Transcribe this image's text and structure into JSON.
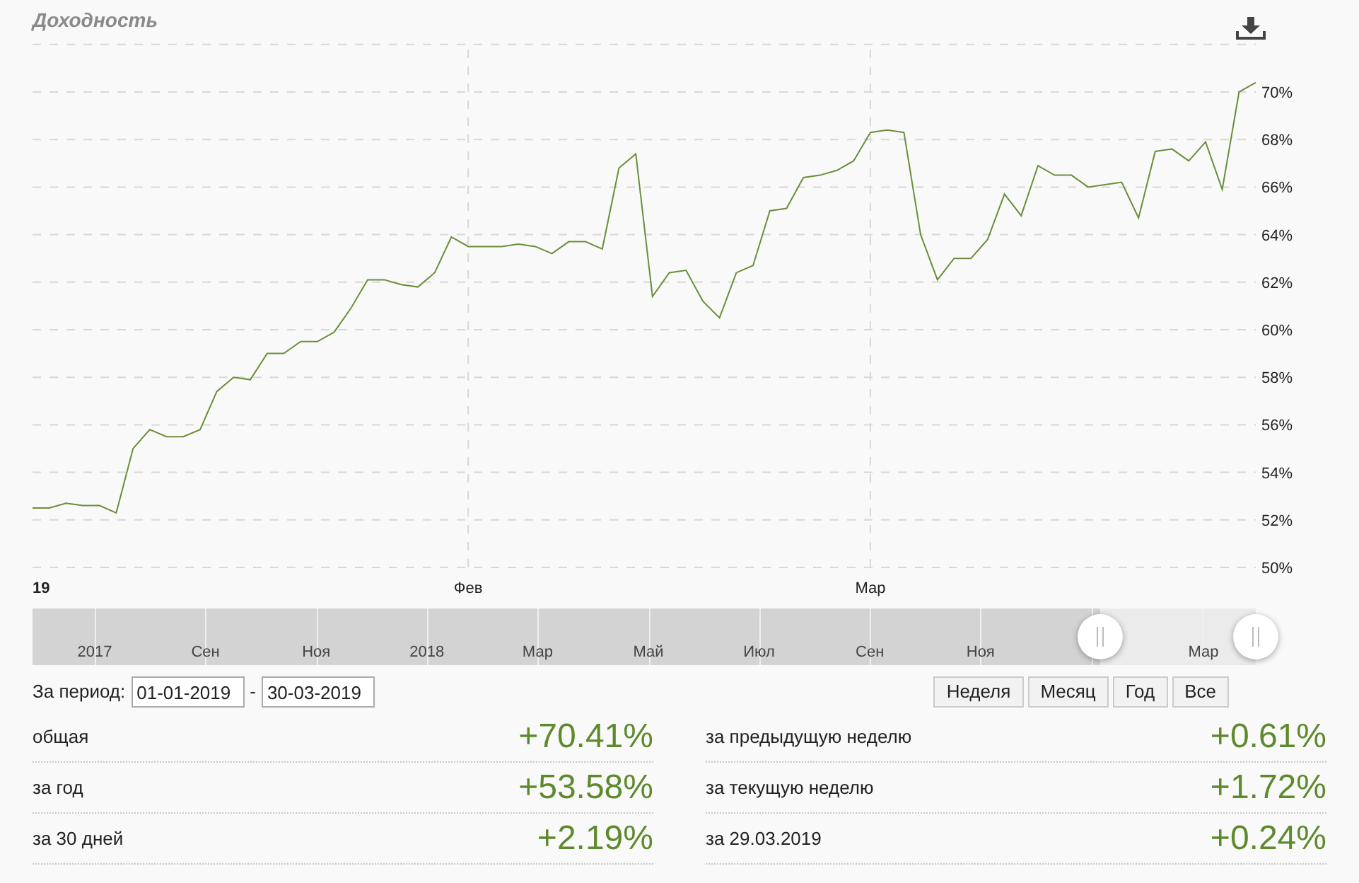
{
  "title": "Доходность",
  "chart": {
    "chart_data": {
      "type": "line",
      "categories": [
        "19",
        null,
        null,
        null,
        null,
        null,
        null,
        null,
        null,
        null,
        null,
        null,
        null,
        null,
        null,
        null,
        null,
        null,
        null,
        null,
        null,
        null,
        null,
        null,
        null,
        null,
        "Фев",
        null,
        null,
        null,
        null,
        null,
        null,
        null,
        null,
        null,
        null,
        null,
        null,
        null,
        null,
        null,
        null,
        null,
        null,
        null,
        null,
        null,
        null,
        null,
        "Мар",
        null,
        null,
        null,
        null,
        null,
        null,
        null,
        null,
        null,
        null,
        null,
        null,
        null,
        null,
        null,
        null,
        null,
        null,
        null,
        null,
        null,
        null,
        null
      ],
      "series": [
        {
          "color": "#6b8e3a",
          "values": [
            52.5,
            52.5,
            52.7,
            52.6,
            52.6,
            52.3,
            55.0,
            55.8,
            55.5,
            55.5,
            55.8,
            57.4,
            58.0,
            57.9,
            59.0,
            59.0,
            59.5,
            59.5,
            59.9,
            60.9,
            62.1,
            62.1,
            61.9,
            61.8,
            62.4,
            63.9,
            63.5,
            63.5,
            63.5,
            63.6,
            63.5,
            63.2,
            63.7,
            63.7,
            63.4,
            66.8,
            67.4,
            61.4,
            62.4,
            62.5,
            61.2,
            60.5,
            62.4,
            62.7,
            65.0,
            65.1,
            66.4,
            66.5,
            66.7,
            67.1,
            68.3,
            68.4,
            68.3,
            64.0,
            62.1,
            63.0,
            63.0,
            63.8,
            65.7,
            64.8,
            66.9,
            66.5,
            66.5,
            66.0,
            66.1,
            66.2,
            64.7,
            67.5,
            67.6,
            67.1,
            67.9,
            65.9,
            70.0,
            70.4
          ]
        }
      ],
      "ylim": [
        50,
        72
      ],
      "grid": true,
      "yticks": [
        {
          "value": 50,
          "label": "50%"
        },
        {
          "value": 52,
          "label": "52%"
        },
        {
          "value": 54,
          "label": "54%"
        },
        {
          "value": 56,
          "label": "56%"
        },
        {
          "value": 58,
          "label": "58%"
        },
        {
          "value": 60,
          "label": "60%"
        },
        {
          "value": 62,
          "label": "62%"
        },
        {
          "value": 64,
          "label": "64%"
        },
        {
          "value": 66,
          "label": "66%"
        },
        {
          "value": 68,
          "label": "68%"
        },
        {
          "value": 70,
          "label": "70%"
        }
      ]
    }
  },
  "navigator": {
    "level": 0.127,
    "labels": [
      "2017",
      "Сен",
      "Ноя",
      "2018",
      "Мар",
      "Май",
      "Июл",
      "Сен",
      "Ноя"
    ],
    "labels_right": [
      "Мар"
    ]
  },
  "period": {
    "label": "За период:",
    "from": "01-01-2019",
    "separator": "-",
    "to": "30-03-2019"
  },
  "range_buttons": [
    {
      "label": "Неделя",
      "selected": false
    },
    {
      "label": "Месяц",
      "selected": false
    },
    {
      "label": "Год",
      "selected": false
    },
    {
      "label": "Все",
      "selected": false
    }
  ],
  "stats_left": [
    {
      "label": "общая",
      "value": "+70.41%"
    },
    {
      "label": "за год",
      "value": "+53.58%"
    },
    {
      "label": "за 30 дней",
      "value": "+2.19%"
    }
  ],
  "stats_right": [
    {
      "label": "за предыдущую неделю",
      "value": "+0.61%"
    },
    {
      "label": "за текущую неделю",
      "value": "+1.72%"
    },
    {
      "label": "за 29.03.2019",
      "value": "+0.24%"
    }
  ]
}
